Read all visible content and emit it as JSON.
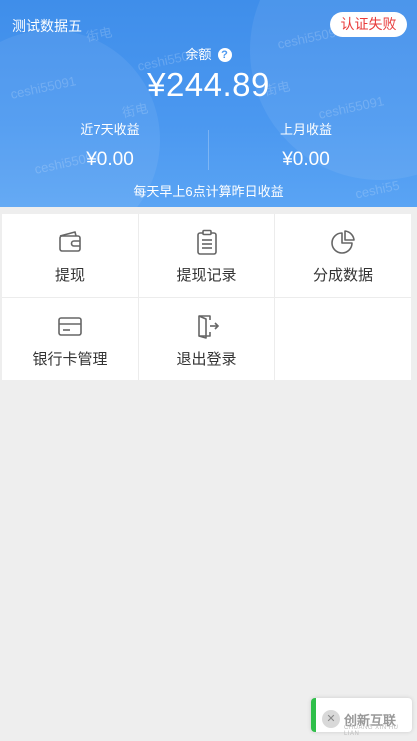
{
  "header": {
    "store_name": "测试数据五",
    "auth_status": "认证失败",
    "balance_label": "余额",
    "balance_help": "?",
    "balance_amount": "¥244.89",
    "stats": [
      {
        "label": "近7天收益",
        "value": "¥0.00"
      },
      {
        "label": "上月收益",
        "value": "¥0.00"
      }
    ],
    "footnote": "每天早上6点计算昨日收益",
    "watermarks": [
      "ceshi55091",
      "ceshi55091",
      "ceshi55091",
      "ceshi55091",
      "ceshi55091",
      "ceshi55",
      "街电",
      "街电",
      "街电"
    ]
  },
  "menu": {
    "items": [
      {
        "label": "提现",
        "icon": "wallet-icon"
      },
      {
        "label": "提现记录",
        "icon": "clipboard-list-icon"
      },
      {
        "label": "分成数据",
        "icon": "pie-chart-icon"
      },
      {
        "label": "银行卡管理",
        "icon": "bank-card-icon"
      },
      {
        "label": "退出登录",
        "icon": "logout-door-icon"
      }
    ]
  },
  "watermark_brand": {
    "name": "创新互联",
    "sub": "CHUANG XIN HU LIAN"
  },
  "colors": {
    "header_blue": "#4b98f0",
    "auth_red": "#e83b3b",
    "float_green": "#2fbf4a"
  }
}
